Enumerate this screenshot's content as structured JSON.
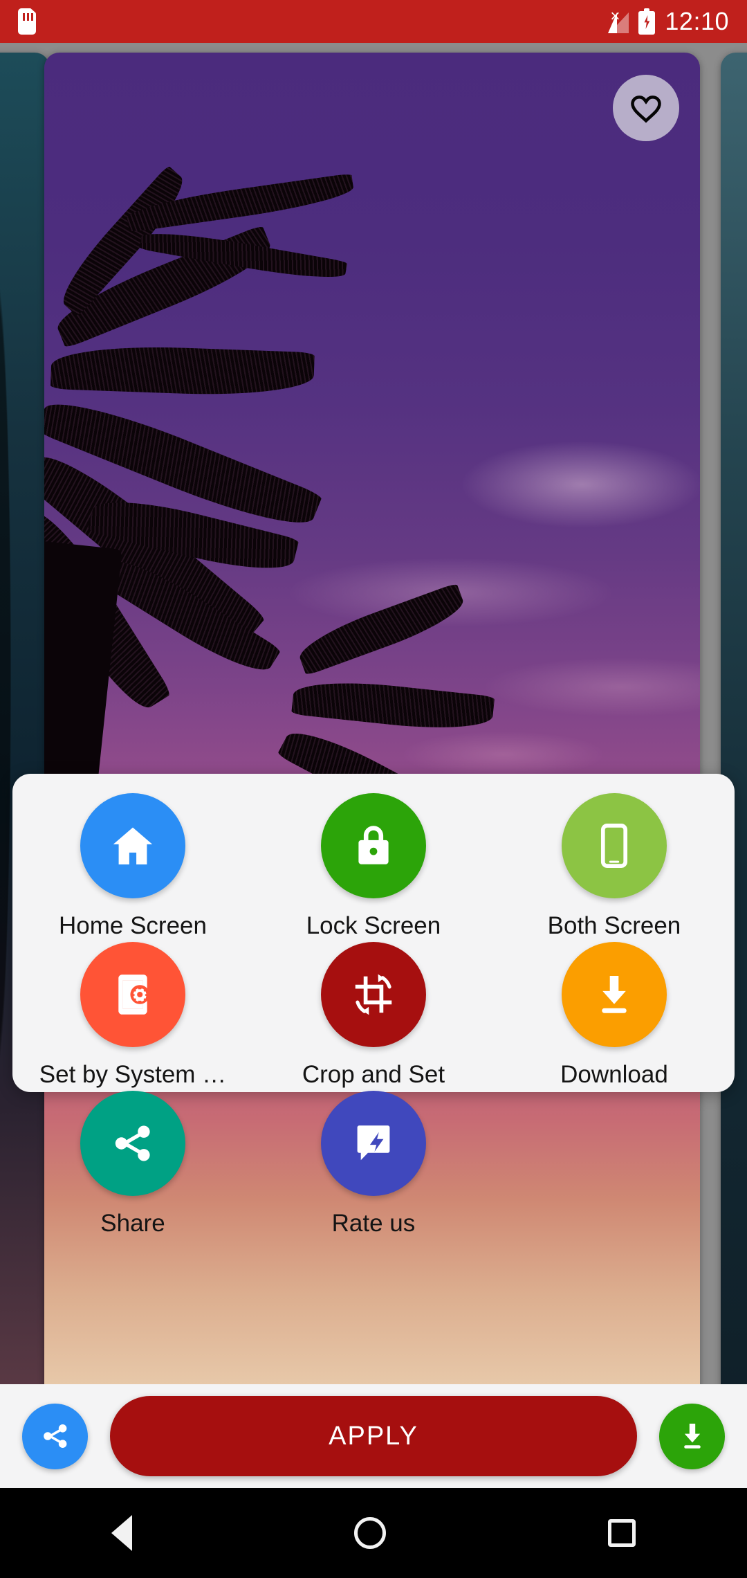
{
  "status_bar": {
    "time": "12:10",
    "icons": [
      "sd-card-icon",
      "signal-no-service-icon",
      "battery-charging-icon"
    ],
    "background_color": "#c0201c"
  },
  "wallpaper": {
    "favorite_icon": "heart-outline-icon",
    "carousel_position": "center",
    "description": "purple and pink sunset sky with palm tree silhouettes"
  },
  "options_sheet": {
    "items": [
      {
        "label": "Home Screen",
        "icon": "home-icon",
        "color": "#2b8ef5"
      },
      {
        "label": "Lock Screen",
        "icon": "lock-icon",
        "color": "#2ca409"
      },
      {
        "label": "Both Screen",
        "icon": "phone-icon",
        "color": "#8cc444"
      },
      {
        "label": "Set by System …",
        "icon": "phone-settings-icon",
        "color": "#ff5436"
      },
      {
        "label": "Crop and Set",
        "icon": "crop-rotate-icon",
        "color": "#a60f0f"
      },
      {
        "label": "Download",
        "icon": "download-icon",
        "color": "#fb9e00"
      },
      {
        "label": "Share",
        "icon": "share-icon",
        "color": "#00a184"
      },
      {
        "label": "Rate us",
        "icon": "rate-review-icon",
        "color": "#4048bd"
      }
    ]
  },
  "bottom_bar": {
    "share_icon": "share-icon",
    "share_color": "#2b8ef5",
    "apply_label": "APPLY",
    "apply_color": "#a60f0f",
    "download_icon": "download-icon",
    "download_color": "#2ca409"
  },
  "navigation_bar": {
    "back": "back-icon",
    "home": "home-circle-icon",
    "recents": "recents-icon"
  }
}
